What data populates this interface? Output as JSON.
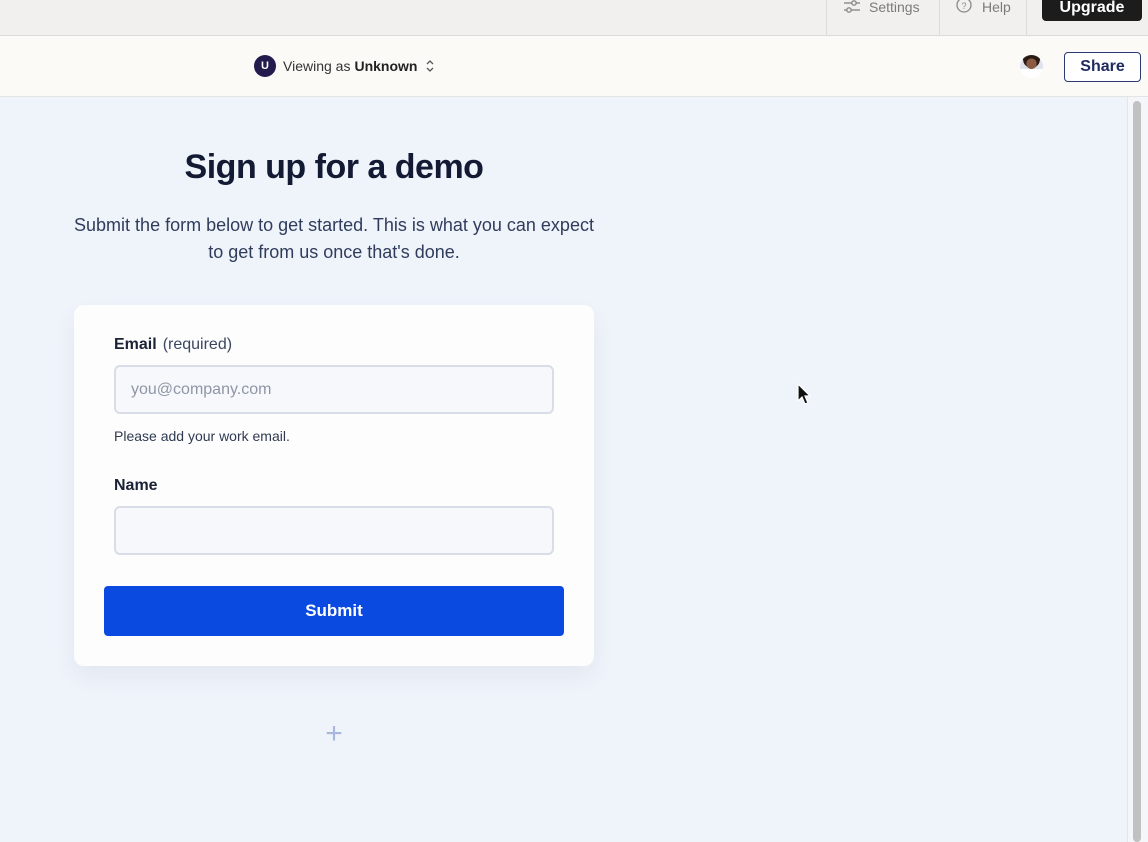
{
  "topbar": {
    "settings_label": "Settings",
    "help_label": "Help",
    "upgrade_label": "Upgrade"
  },
  "header": {
    "viewer_badge": "U",
    "viewing_prefix": "Viewing as",
    "viewing_user": "Unknown",
    "share_label": "Share"
  },
  "page": {
    "title": "Sign up for a demo",
    "subtitle": "Submit the form below to get started. This is what you can expect to get from us once that's done."
  },
  "form": {
    "email_label": "Email",
    "email_required": "(required)",
    "email_placeholder": "you@company.com",
    "email_value": "",
    "email_hint": "Please add your work email.",
    "name_label": "Name",
    "name_value": "",
    "submit_label": "Submit"
  },
  "add_block_icon": "+",
  "colors": {
    "accent": "#0a4ae0",
    "canvas_bg": "#eff3fa",
    "header_bg": "#fbfaf7",
    "badge_bg": "#231a4d",
    "upgrade_bg": "#1c1c1c"
  }
}
